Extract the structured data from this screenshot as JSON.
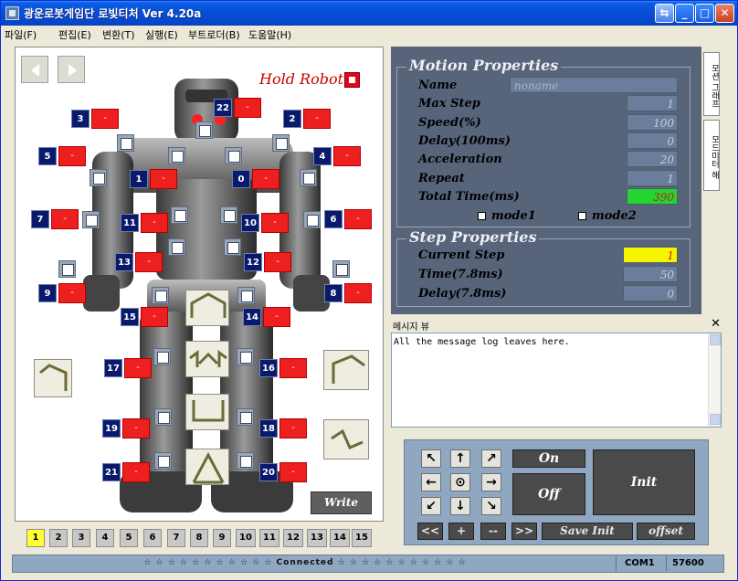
{
  "window": {
    "title": "광운로봇게임단 로빛티처 Ver 4.20a",
    "controls": {
      "minimize": "_",
      "maximize": "□",
      "close": "✕",
      "help": "⇆"
    }
  },
  "menu": [
    "파일(F)",
    "편집(E)",
    "변환(T)",
    "실행(E)",
    "부트로더(B)",
    "도움말(H)"
  ],
  "robot": {
    "hold_label": "Hold Robot",
    "nav": {
      "prev": "prev-icon",
      "next": "next-icon"
    },
    "servos": [
      {
        "num": "22",
        "val": "-"
      },
      {
        "num": "3",
        "val": "-"
      },
      {
        "num": "2",
        "val": "-"
      },
      {
        "num": "5",
        "val": "-"
      },
      {
        "num": "4",
        "val": "-"
      },
      {
        "num": "1",
        "val": "-"
      },
      {
        "num": "0",
        "val": "-"
      },
      {
        "num": "7",
        "val": "-"
      },
      {
        "num": "11",
        "val": "-"
      },
      {
        "num": "10",
        "val": "-"
      },
      {
        "num": "6",
        "val": "-"
      },
      {
        "num": "13",
        "val": "-"
      },
      {
        "num": "12",
        "val": "-"
      },
      {
        "num": "9",
        "val": "-"
      },
      {
        "num": "8",
        "val": "-"
      },
      {
        "num": "15",
        "val": "-"
      },
      {
        "num": "14",
        "val": "-"
      },
      {
        "num": "17",
        "val": "-"
      },
      {
        "num": "16",
        "val": "-"
      },
      {
        "num": "19",
        "val": "-"
      },
      {
        "num": "18",
        "val": "-"
      },
      {
        "num": "21",
        "val": "-"
      },
      {
        "num": "20",
        "val": "-"
      }
    ],
    "write_label": "Write",
    "steps": [
      "1",
      "2",
      "3",
      "4",
      "5",
      "6",
      "7",
      "8",
      "9",
      "10",
      "11",
      "12",
      "13",
      "14",
      "15"
    ],
    "active_step": "1"
  },
  "motion_properties": {
    "title": "Motion Properties",
    "name_label": "Name",
    "name_value": "noname",
    "max_step_label": "Max Step",
    "max_step_value": "1",
    "speed_label": "Speed(%)",
    "speed_value": "100",
    "delay_label": "Delay(100ms)",
    "delay_value": "0",
    "acceleration_label": "Acceleration",
    "acceleration_value": "20",
    "repeat_label": "Repeat",
    "repeat_value": "1",
    "total_time_label": "Total Time(ms)",
    "total_time_value": "390",
    "mode1_label": "mode1",
    "mode2_label": "mode2"
  },
  "step_properties": {
    "title": "Step Properties",
    "current_step_label": "Current Step",
    "current_step_value": "1",
    "time_label": "Time(7.8ms)",
    "time_value": "50",
    "delay_label": "Delay(7.8ms)",
    "delay_value": "0"
  },
  "side_tabs": [
    "모션 그래프",
    "모드미터 해"
  ],
  "message_view": {
    "title": "메시지 뷰",
    "close": "✕",
    "log": "All the message log leaves here."
  },
  "controls": {
    "directions": [
      "↖",
      "↑",
      "↗",
      "←",
      "⊙",
      "→",
      "↙",
      "↓",
      "↘"
    ],
    "on_label": "On",
    "off_label": "Off",
    "init_label": "Init",
    "rewind": "<<",
    "plus": "+",
    "minus": "--",
    "forward": ">>",
    "save_init_label": "Save Init",
    "offset_label": "offset"
  },
  "status": {
    "text": "☆ ☆ ☆ ☆ ☆ ☆ ☆ ☆ ☆ ☆ ☆   Connected   ☆ ☆ ☆ ☆ ☆ ☆ ☆ ☆ ☆ ☆ ☆",
    "port": "COM1",
    "baud": "57600"
  }
}
